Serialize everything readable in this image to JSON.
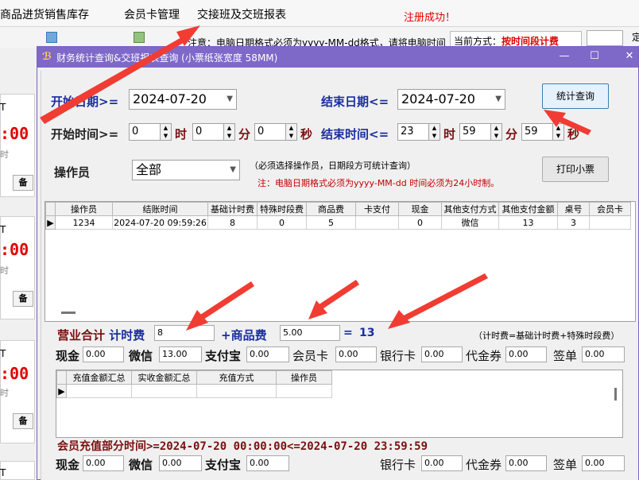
{
  "menu": {
    "items": [
      "商品进货销售库存",
      "会员卡管理",
      "交接班及交班报表"
    ],
    "notice": "注册成功！"
  },
  "bg": {
    "warning": "注意：电脑日期格式必须为yyyy-MM-dd格式，请将电脑时间",
    "method_label": "当前方式：",
    "method_value": "按时间段计费",
    "cut": "定",
    "red_time": ":00",
    "btn": "备",
    "side_btn": "T",
    "side_text": "时"
  },
  "dialog": {
    "title": "财务统计查询&交班报表查询 (小票纸张宽度 58MM)"
  },
  "filters": {
    "start_date_label": "开始日期>=",
    "start_date": "2024-07-20",
    "end_date_label": "结束日期<=",
    "end_date": "2024-07-20",
    "start_time_label": "开始时间>=",
    "end_time_label": "结束时间<=",
    "start_h": "0",
    "start_m": "0",
    "start_s": "0",
    "end_h": "23",
    "end_m": "59",
    "end_s": "59",
    "unit_h": "时",
    "unit_m": "分",
    "unit_s": "秒",
    "operator_label": "操作员",
    "operator_value": "全部",
    "operator_hint": "（必须选择操作员，日期段方可统计查询）",
    "format_note": "注：电脑日期格式必须为yyyy-MM-dd 时间必须为24小时制。",
    "query_button": "统计查询",
    "print_button": "打印小票"
  },
  "table1": {
    "headers": [
      "操作员",
      "结账时间",
      "基础计时费",
      "特殊时段费",
      "商品费",
      "卡支付",
      "现金",
      "其他支付方式",
      "其他支付金额",
      "桌号",
      "会员卡"
    ],
    "rows": [
      [
        "1234",
        "2024-07-20 09:59:26",
        "8",
        "0",
        "5",
        "",
        "0",
        "微信",
        "13",
        "3",
        ""
      ]
    ]
  },
  "summary": {
    "title": "营业合计",
    "time_fee_label": "计时费",
    "time_fee": "8",
    "goods_fee_label": "+商品费",
    "goods_fee": "5.00",
    "equals": "=",
    "total": "13",
    "formula": "（计时费=基础计时费+特殊时段费）"
  },
  "pay1": {
    "cash_label": "现金",
    "cash": "0.00",
    "wechat_label": "微信",
    "wechat": "13.00",
    "alipay_label": "支付宝",
    "alipay": "0.00",
    "member_label": "会员卡",
    "member": "0.00",
    "bank_label": "银行卡",
    "bank": "0.00",
    "voucher_label": "代金券",
    "voucher": "0.00",
    "sign_label": "签单",
    "sign": "0.00"
  },
  "table2": {
    "headers": [
      "充值金额汇总",
      "实收金额汇总",
      "充值方式",
      "操作员"
    ]
  },
  "recharge": {
    "line": "会员充值部分时间>=2024-07-20 00:00:00<=2024-07-20 23:59:59"
  },
  "pay2": {
    "cash_label": "现金",
    "cash": "0.00",
    "wechat_label": "微信",
    "wechat": "0.00",
    "alipay_label": "支付宝",
    "alipay": "0.00",
    "bank_label": "银行卡",
    "bank": "0.00",
    "voucher_label": "代金券",
    "voucher": "0.00",
    "sign_label": "签单",
    "sign": "0.00"
  },
  "colors": {
    "title_bar": "#7e68c8",
    "label_blue": "#1a2ea0",
    "label_brown": "#7a1010",
    "notice_red": "#e00000",
    "arrow": "#f03c32"
  }
}
